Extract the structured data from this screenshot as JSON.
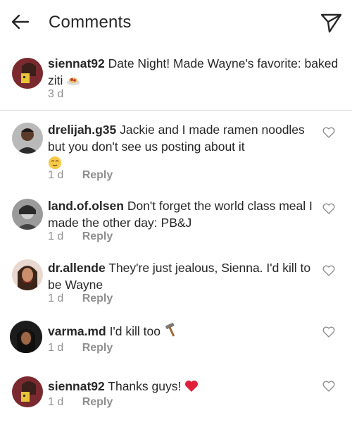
{
  "header": {
    "title": "Comments"
  },
  "caption": {
    "username": "siennat92",
    "text": "Date Night! Made Wayne's favorite: baked ziti",
    "time": "3 d"
  },
  "comments": [
    {
      "username": "drelijah.g35",
      "text": "Jackie and I made ramen noodles but you don't see us posting about it",
      "time": "1 d",
      "reply": "Reply"
    },
    {
      "username": "land.of.olsen",
      "text": "Don't forget the world class meal I made the other day: PB&J",
      "time": "1 d",
      "reply": "Reply"
    },
    {
      "username": "dr.allende",
      "text": "They're just jealous, Sienna. I'd kill to be Wayne",
      "time": "1 d",
      "reply": "Reply"
    },
    {
      "username": "varma.md",
      "text": "I'd kill too",
      "time": "1 d",
      "reply": "Reply"
    },
    {
      "username": "siennat92",
      "text": "Thanks guys!",
      "time": "1 d",
      "reply": "Reply"
    }
  ],
  "icons": {
    "back": "arrow-left-icon",
    "send": "paper-plane-icon",
    "like": "heart-outline-icon",
    "caption_emoji": "spaghetti-emoji",
    "comment1_emoji": "relieved-face-emoji",
    "comment4_emoji": "hammer-emoji",
    "comment5_emoji": "red-heart-emoji"
  },
  "colors": {
    "text": "#262626",
    "secondary": "#8e8e8e",
    "divider": "#dbdbdb",
    "heart": "#e0203a"
  }
}
